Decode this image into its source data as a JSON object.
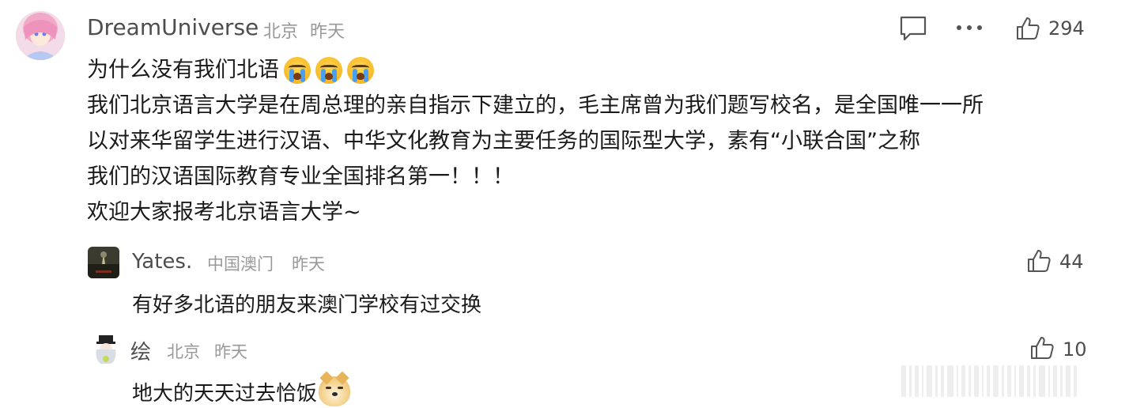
{
  "main_comment": {
    "username": "DreamUniverse",
    "location": "北京",
    "time": "昨天",
    "like_count": "294",
    "lines": [
      "为什么没有我们北语",
      "我们北京语言大学是在周总理的亲自指示下建立的，毛主席曾为我们题写校名，是全国唯一一所",
      "以对来华留学生进行汉语、中华文化教育为主要任务的国际型大学，素有“小联合国”之称",
      "我们的汉语国际教育专业全国排名第一！！！",
      "欢迎大家报考北京语言大学~"
    ],
    "emoji": [
      "loudly-crying-face",
      "loudly-crying-face",
      "loudly-crying-face"
    ]
  },
  "replies": [
    {
      "username": "Yates.",
      "location": "中国澳门",
      "time": "昨天",
      "text": "有好多北语的朋友来澳门学校有过交换",
      "like_count": "44"
    },
    {
      "username": "绘",
      "location": "北京",
      "time": "昨天",
      "text": "地大的天天过去恰饭",
      "like_count": "10",
      "emoji": "doge"
    }
  ],
  "icons": {
    "comment": "comment-icon",
    "more": "more-icon",
    "like": "thumbs-up-icon"
  },
  "colors": {
    "text_primary": "#1a1a1a",
    "text_secondary": "#4d4d4d",
    "text_meta": "#999999",
    "background": "#ffffff"
  }
}
